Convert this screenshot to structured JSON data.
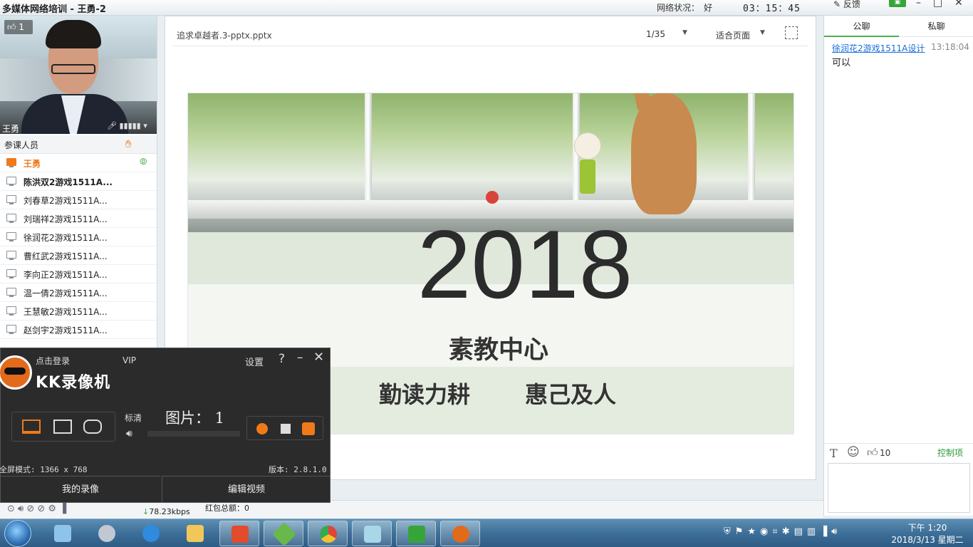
{
  "titlebar": {
    "app_title": "多媒体网络培训 - 王勇-2",
    "net_label": "网络状况：",
    "net_value": "好",
    "clock": "03：15：45",
    "feedback": "反馈"
  },
  "video": {
    "like_count": "1",
    "presenter_name": "王勇"
  },
  "participants": {
    "title": "参课人员",
    "items": [
      {
        "name": "王勇",
        "role": "host"
      },
      {
        "name": "陈洪双2游戏1511A..."
      },
      {
        "name": "刘春草2游戏1511A..."
      },
      {
        "name": "刘瑞祥2游戏1511A..."
      },
      {
        "name": "徐润花2游戏1511A..."
      },
      {
        "name": "曹红武2游戏1511A..."
      },
      {
        "name": "李向正2游戏1511A..."
      },
      {
        "name": "温一倩2游戏1511A..."
      },
      {
        "name": "王慧敏2游戏1511A..."
      },
      {
        "name": "赵剑宇2游戏1511A..."
      }
    ]
  },
  "document": {
    "filename": "追求卓越者.3-pptx.pptx",
    "page": "1/35",
    "zoom": "适合页面"
  },
  "slide": {
    "year": "2018",
    "org": "素教中心",
    "motto_left": "勤读力耕",
    "motto_right": "惠己及人"
  },
  "chat": {
    "tab_public": "公聊",
    "tab_private": "私聊",
    "message": {
      "sender": "徐润花2游戏1511A设计",
      "time": "13:18:04",
      "text": "可以"
    },
    "like_count": "10",
    "control": "控制项"
  },
  "kk": {
    "login": "点击登录",
    "vip": "VIP",
    "brand": "KK录像机",
    "settings": "设置",
    "quality": "标清",
    "images": "图片： 1",
    "fullscreen_mode": "全屏模式: 1366 x 768",
    "version": "版本: 2.8.1.0",
    "my_recordings": "我的录像",
    "edit_video": "编辑视频"
  },
  "status": {
    "bitrate": "78.23kbps",
    "redpack": "红包总额：0"
  },
  "taskbar": {
    "time": "下午 1:20",
    "date": "2018/3/13 星期二",
    "apps": [
      "control-panel",
      "webcam",
      "sogou",
      "file-explorer",
      "html-editor",
      "draw-app",
      "chrome",
      "notes",
      "greenshot",
      "kk-recorder"
    ]
  },
  "colors": {
    "accent_orange": "#f07a1a",
    "link_blue": "#1a6fd8",
    "green": "#2e9a3a",
    "recorder_bg": "#2b2b2b"
  }
}
